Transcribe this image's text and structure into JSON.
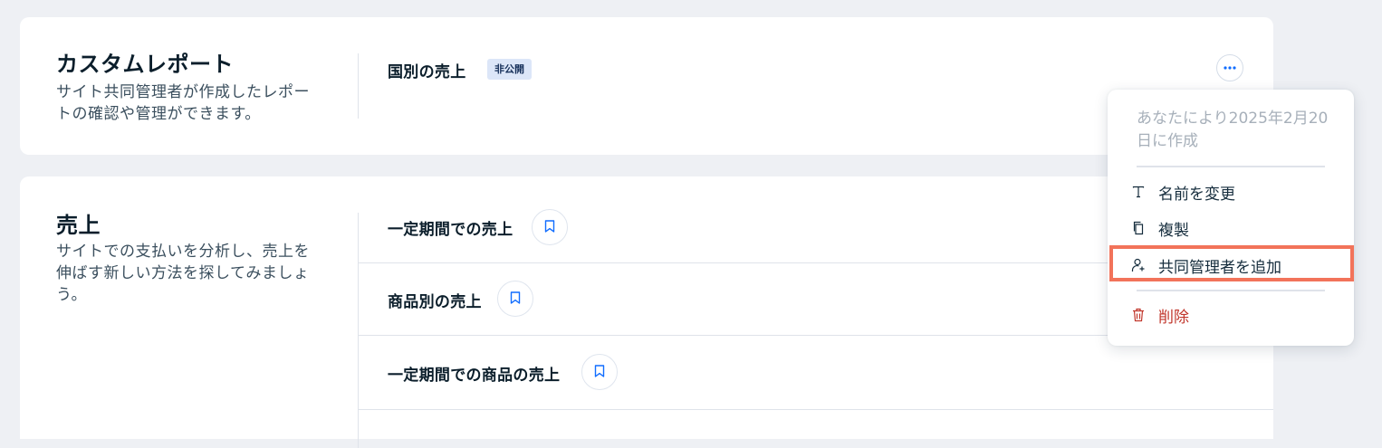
{
  "custom_reports": {
    "title": "カスタムレポート",
    "description": "サイト共同管理者が作成したレポートの確認や管理ができます。",
    "report": {
      "name": "国別の売上",
      "badge": "非公開"
    }
  },
  "sales": {
    "title": "売上",
    "description": "サイトでの支払いを分析し、売上を伸ばす新しい方法を探してみましょう。",
    "reports": [
      {
        "name": "一定期間での売上"
      },
      {
        "name": "商品別の売上"
      },
      {
        "name": "一定期間での商品の売上"
      }
    ]
  },
  "context_menu": {
    "meta": "あなたにより2025年2月20日に作成",
    "items": [
      {
        "label": "名前を変更",
        "icon": "text-icon"
      },
      {
        "label": "複製",
        "icon": "duplicate-icon"
      },
      {
        "label": "共同管理者を追加",
        "icon": "add-person-icon",
        "highlighted": true
      },
      {
        "label": "削除",
        "icon": "trash-icon",
        "danger": true
      }
    ]
  },
  "colors": {
    "accent": "#116dff",
    "danger": "#c1362b",
    "highlight": "#f2735a",
    "badge_bg": "#dce6f8"
  }
}
